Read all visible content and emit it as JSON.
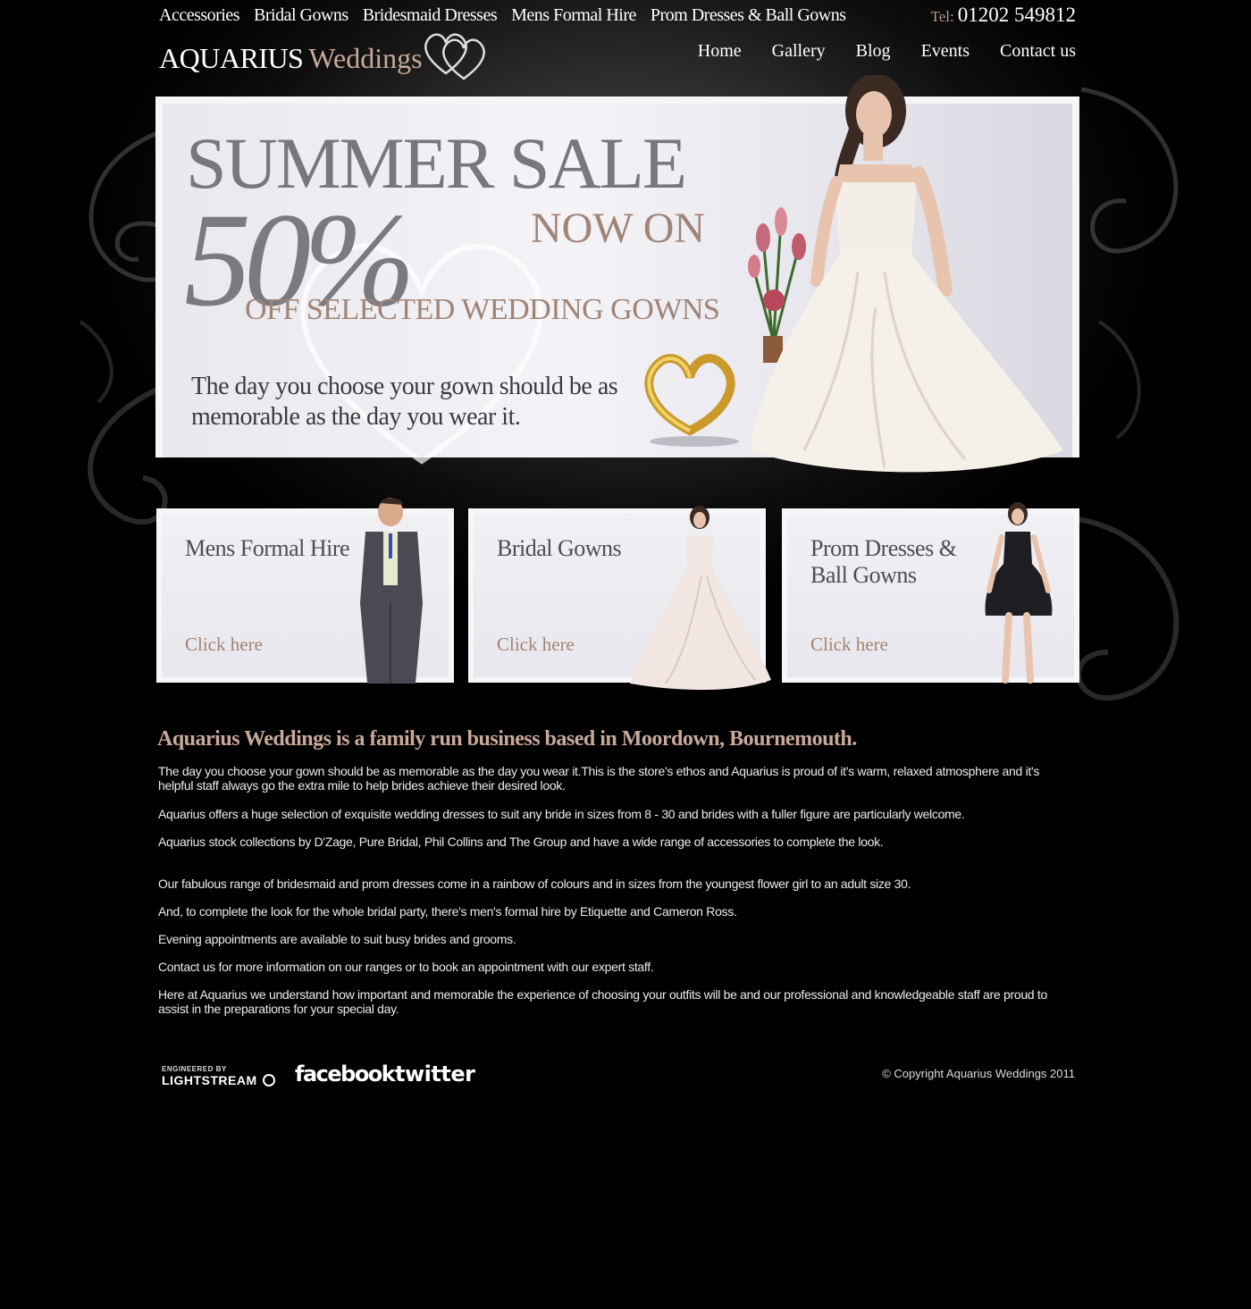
{
  "top_links": [
    "Accessories",
    "Bridal Gowns",
    "Bridesmaid Dresses",
    "Mens Formal Hire",
    "Prom Dresses & Ball Gowns"
  ],
  "tel": {
    "label": "Tel:",
    "number": "01202 549812"
  },
  "logo": {
    "brand": "AQUARIUS",
    "suffix": "Weddings"
  },
  "main_nav": [
    "Home",
    "Gallery",
    "Blog",
    "Events",
    "Contact us"
  ],
  "hero": {
    "title": "SUMMER SALE",
    "now_on": "NOW ON",
    "percent": "50%",
    "off": "OFF SELECTED WEDDING GOWNS",
    "tagline": "The day you choose your gown should be as memorable as the day you wear it."
  },
  "cards": [
    {
      "title": "Mens Formal Hire",
      "link": "Click here"
    },
    {
      "title": "Bridal Gowns",
      "link": "Click here"
    },
    {
      "title": "Prom Dresses & Ball Gowns",
      "link": "Click here"
    }
  ],
  "intro": {
    "heading": "Aquarius Weddings is a family run business based in Moordown, Bournemouth.",
    "paragraphs": [
      "The day you choose your gown should be as memorable as the day you wear it.This is the store's ethos and Aquarius is proud of it's warm, relaxed atmosphere and it's helpful staff always go the extra mile to help brides achieve their desired look.",
      "Aquarius offers a huge selection of exquisite wedding dresses to suit any bride in sizes from 8 - 30 and brides with a fuller figure are particularly welcome.",
      "Aquarius stock collections by D'Zage, Pure Bridal, Phil Collins and The Group and have a wide range of accessories to complete the look.",
      "Our fabulous range of bridesmaid and prom dresses come in a rainbow of colours and in sizes from the youngest flower girl to an adult size 30.",
      "And, to complete the look for the whole bridal party, there's men's formal hire by Etiquette and Cameron Ross.",
      "Evening appointments are available to suit busy brides and grooms.",
      "Contact us for more information on our ranges or to book an appointment with our expert staff.",
      "Here at Aquarius we understand how important and memorable the experience of choosing your outfits will be and our professional and knowledgeable staff are proud to assist in the preparations for your special day."
    ]
  },
  "footer": {
    "engineered_by": "ENGINEERED BY",
    "lightstream": "LIGHTSTREAM",
    "facebook": "facebook",
    "twitter": "twitter",
    "copyright": "© Copyright Aquarius Weddings 2011"
  },
  "colors": {
    "accent": "#a08476",
    "heading_accent": "#c9a99a",
    "background": "#000000"
  }
}
